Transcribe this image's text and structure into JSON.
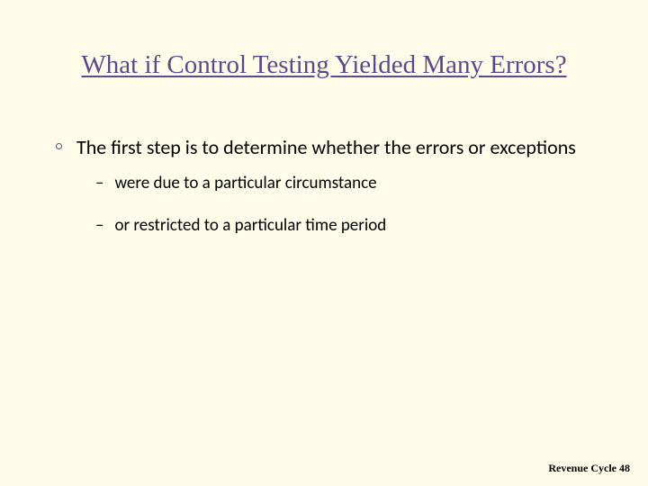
{
  "title": "What if Control Testing Yielded Many Errors?",
  "bullet": "The first step is to determine whether the errors or exceptions",
  "subitems": [
    "were due to a particular circumstance",
    "or restricted to a particular time period"
  ],
  "footer": "Revenue Cycle 48"
}
